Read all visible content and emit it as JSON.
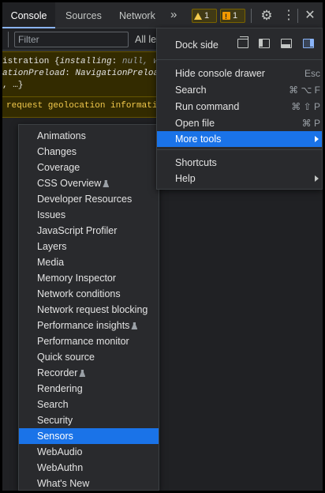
{
  "tabs": {
    "console": "Console",
    "sources": "Sources",
    "network": "Network",
    "more": "»"
  },
  "badges": {
    "warnings": "1",
    "issues": "1"
  },
  "toolbar": {
    "filter_placeholder": "Filter",
    "levels": "All le"
  },
  "console": {
    "msg1_line1_prefix": "istration {",
    "msg1_line1_key": "installing",
    "msg1_line1_sep": ": ",
    "msg1_line1_val": "null",
    "msg1_line1_rest": ", w",
    "msg1_line2_key": "ationPreload",
    "msg1_line2_sep": ": ",
    "msg1_line2_val": "NavigationPreloadM",
    "msg1_line3": ", …}",
    "msg2": "request geolocation informati"
  },
  "main_menu": {
    "dock_side": "Dock side",
    "hide_drawer": "Hide console drawer",
    "hide_drawer_shortcut": "Esc",
    "search": "Search",
    "search_shortcut": "⌘ ⌥ F",
    "run_command": "Run command",
    "run_command_shortcut": "⌘ ⇧ P",
    "open_file": "Open file",
    "open_file_shortcut": "⌘ P",
    "more_tools": "More tools",
    "shortcuts": "Shortcuts",
    "help": "Help"
  },
  "more_tools": [
    {
      "label": "Animations",
      "experimental": false
    },
    {
      "label": "Changes",
      "experimental": false
    },
    {
      "label": "Coverage",
      "experimental": false
    },
    {
      "label": "CSS Overview",
      "experimental": true
    },
    {
      "label": "Developer Resources",
      "experimental": false
    },
    {
      "label": "Issues",
      "experimental": false
    },
    {
      "label": "JavaScript Profiler",
      "experimental": false
    },
    {
      "label": "Layers",
      "experimental": false
    },
    {
      "label": "Media",
      "experimental": false
    },
    {
      "label": "Memory Inspector",
      "experimental": false
    },
    {
      "label": "Network conditions",
      "experimental": false
    },
    {
      "label": "Network request blocking",
      "experimental": false
    },
    {
      "label": "Performance insights",
      "experimental": true
    },
    {
      "label": "Performance monitor",
      "experimental": false
    },
    {
      "label": "Quick source",
      "experimental": false
    },
    {
      "label": "Recorder",
      "experimental": true
    },
    {
      "label": "Rendering",
      "experimental": false
    },
    {
      "label": "Search",
      "experimental": false
    },
    {
      "label": "Security",
      "experimental": false
    },
    {
      "label": "Sensors",
      "experimental": false,
      "selected": true
    },
    {
      "label": "WebAudio",
      "experimental": false
    },
    {
      "label": "WebAuthn",
      "experimental": false
    },
    {
      "label": "What's New",
      "experimental": false
    }
  ],
  "colors": {
    "accent": "#1a73e8",
    "warning": "#f2c94c",
    "background": "#202124"
  },
  "icons": {
    "settings": "gear-icon",
    "menu": "kebab-icon",
    "close": "close-icon",
    "experiment": "flask-icon"
  }
}
